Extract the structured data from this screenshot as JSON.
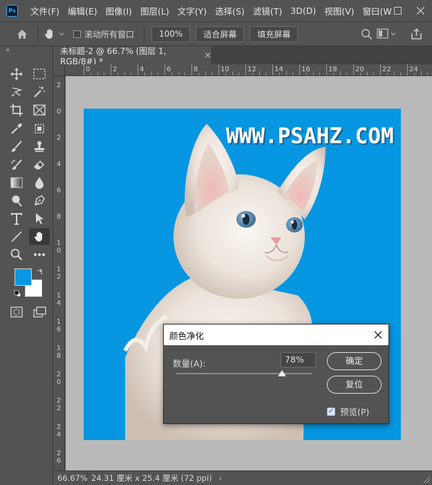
{
  "app": {
    "logo": "Ps"
  },
  "menu": [
    "文件(F)",
    "编辑(E)",
    "图像(I)",
    "图层(L)",
    "文字(Y)",
    "选择(S)",
    "滤镜(T)",
    "3D(D)",
    "视图(V)",
    "窗口(W"
  ],
  "options": {
    "scroll_all_windows": "滚动所有窗口",
    "zoom": "100%",
    "fit_screen": "适合屏幕",
    "fill_screen": "填充屏幕"
  },
  "document": {
    "tab_title": "未标题-2 @ 66.7% (图层 1, RGB/8#) *",
    "watermark": "WWW.PSAHZ.COM"
  },
  "rulers": {
    "horizontal": [
      "0",
      "2",
      "4",
      "6",
      "8",
      "10",
      "12",
      "14",
      "16",
      "18",
      "20",
      "22",
      "24"
    ],
    "vertical": [
      "2",
      "0",
      "2",
      "4",
      "6",
      "8",
      "1\n0",
      "1\n2",
      "1\n4",
      "1\n6",
      "1\n8",
      "2\n0",
      "2\n2",
      "2\n4",
      "2\n6"
    ]
  },
  "status": {
    "zoom": "66.67%",
    "doc_size": "24.31 厘米 x 25.4 厘米 (72 ppi)"
  },
  "dialog": {
    "title": "颜色净化",
    "amount_label": "数量(A):",
    "amount_value": "78%",
    "amount_fraction": 0.78,
    "ok_label": "确定",
    "reset_label": "复位",
    "preview_label": "预览(P)",
    "preview_checked": true
  },
  "colors": {
    "foreground": "#0a97e2",
    "background": "#ffffff",
    "canvas": "#0696e2"
  }
}
